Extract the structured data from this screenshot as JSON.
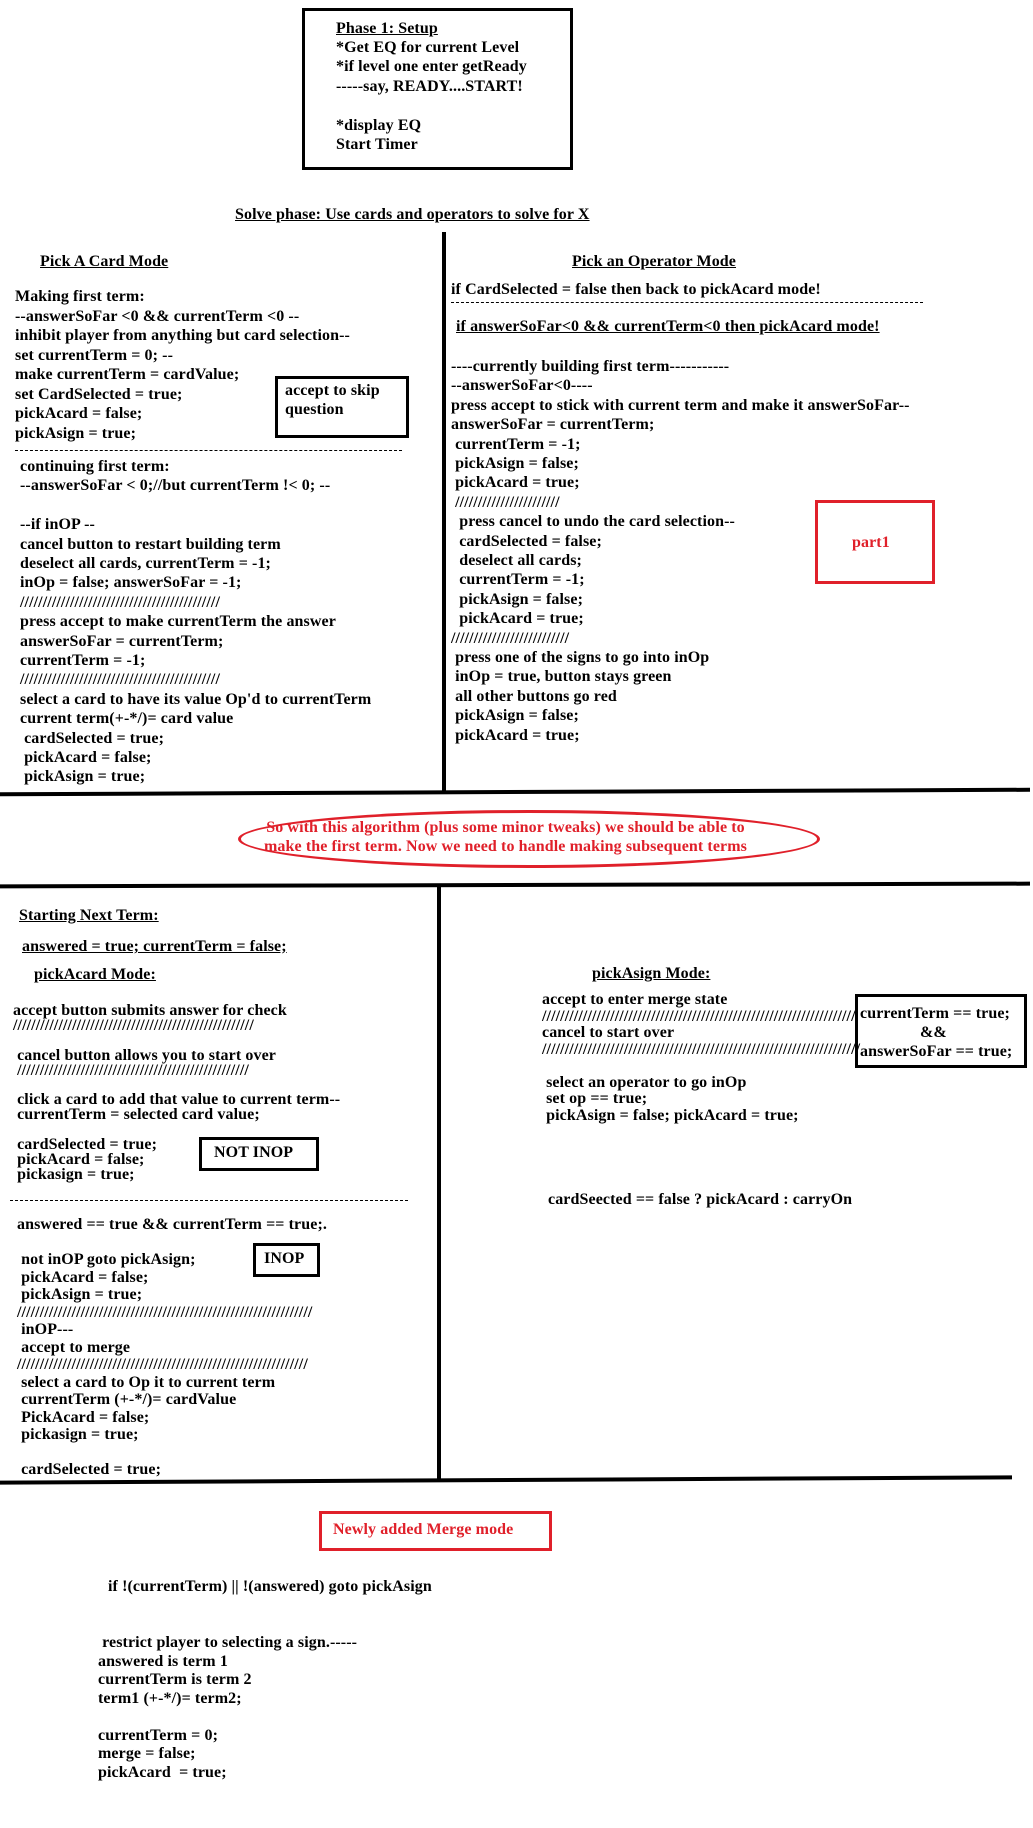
{
  "phase1": {
    "title": "Phase 1: Setup",
    "lines": [
      "*Get EQ for current Level",
      "*if level one enter getReady",
      "-----say, READY....START!",
      "",
      "*display EQ",
      "Start Timer"
    ]
  },
  "solve_header": "Solve phase: Use cards and operators to solve for X",
  "pick_card": {
    "title": "Pick A Card Mode",
    "block1": [
      "Making first term:",
      "--answerSoFar <0 && currentTerm <0 --",
      "inhibit player from anything but card selection--",
      "set currentTerm = 0; --",
      "make currentTerm = cardValue;",
      "set CardSelected = true;",
      "pickAcard = false;",
      "pickAsign = true;"
    ],
    "accept_box": "accept to skip\nquestion",
    "block2": [
      "continuing first term:",
      "--answerSoFar < 0;//but currentTerm !< 0; --",
      "",
      "--if inOP --",
      "cancel button to restart building term",
      "deselect all cards, currentTerm = -1;",
      "inOp = false; answerSoFar = -1;",
      "////////////////////////////////////////////",
      "press accept to make currentTerm the answer",
      "answerSoFar = currentTerm;",
      "currentTerm = -1;",
      "////////////////////////////////////////////",
      "select a card to have its value Op'd to currentTerm",
      "current term(+-*/)= card value",
      " cardSelected = true;",
      " pickAcard = false;",
      " pickAsign = true;"
    ]
  },
  "pick_operator": {
    "title": "Pick an Operator Mode",
    "line1": "if CardSelected = false then back to pickAcard mode!",
    "line2": "if answerSoFar<0 && currentTerm<0 then pickAcard mode!",
    "block": [
      "----currently building first term-----------",
      "--answerSoFar<0----",
      "press accept to stick with current term and make it answerSoFar--",
      "answerSoFar = currentTerm;",
      " currentTerm = -1;",
      " pickAsign = false;",
      " pickAcard = true;",
      " ///////////////////////",
      "  press cancel to undo the card selection--",
      "  cardSelected = false;",
      "  deselect all cards;",
      "  currentTerm = -1;",
      "  pickAsign = false;",
      "  pickAcard = true;",
      "//////////////////////////",
      " press one of the signs to go into inOp",
      " inOp = true, button stays green",
      " all other buttons go red",
      " pickAsign = false;",
      " pickAcard = true;"
    ],
    "part1_label": "part1"
  },
  "note": "So with this algorithm (plus some minor tweaks) we should be able to\nmake the first term. Now we need to handle making subsequent terms",
  "next_term": {
    "title": "Starting Next Term:",
    "line": "answered = true; currentTerm = false;",
    "subtitle": "pickAcard Mode:",
    "block1": [
      "accept button submits answer for check",
      "/////////////////////////////////////////////////////",
      "",
      " cancel button allows you to start over",
      " ///////////////////////////////////////////////////",
      "",
      " click a card to add that value to current term--",
      " currentTerm = selected card value;",
      "",
      " cardSelected = true;",
      " pickAcard = false;",
      " pickasign = true;"
    ],
    "not_inop": "NOT INOP",
    "block2": [
      "answered == true && currentTerm == true;.",
      "",
      " not inOP goto pickAsign;",
      " pickAcard = false;",
      " pickAsign = true;",
      "/////////////////////////////////////////////////////////////////",
      " inOP---",
      " accept to merge",
      "////////////////////////////////////////////////////////////////",
      " select a card to Op it to current term",
      " currentTerm (+-*/)= cardValue",
      " PickAcard = false;",
      " pickasign = true;",
      "",
      " cardSelected = true;"
    ],
    "inop": "INOP"
  },
  "pick_asign": {
    "title": "pickAsign Mode:",
    "block": [
      "accept to enter merge state",
      "/////////////////////////////////////////////////////////////////////",
      "cancel to start over",
      "//////////////////////////////////////////////////////////////////////",
      "",
      " select an operator to go inOp",
      " set op == true;",
      " pickAsign = false; pickAcard = true;"
    ],
    "box": [
      "currentTerm == true;",
      "&&",
      "answerSoFar == true;"
    ],
    "carry": "cardSeected == false ? pickAcard : carryOn"
  },
  "merge": {
    "title": "Newly added Merge mode",
    "line1": "if !(currentTerm) || !(answered) goto pickAsign",
    "block": [
      " restrict player to selecting a sign.-----",
      "answered is term 1",
      "currentTerm is term 2",
      "term1 (+-*/)= term2;",
      "",
      "currentTerm = 0;",
      "merge = false;",
      "pickAcard  = true;"
    ]
  }
}
